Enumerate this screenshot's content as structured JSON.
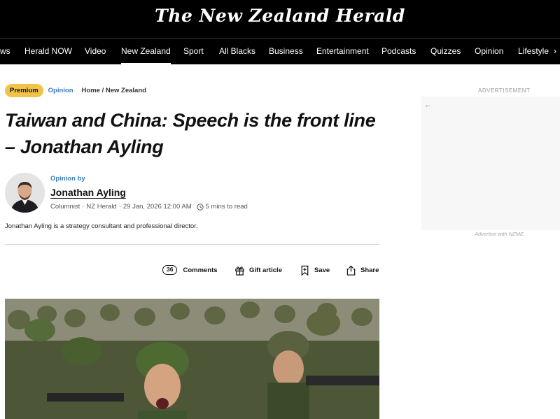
{
  "header": {
    "masthead": "The New Zealand Herald",
    "nav": [
      {
        "label": "ws"
      },
      {
        "label": "Herald NOW"
      },
      {
        "label": "Video"
      },
      {
        "label": "New Zealand",
        "active": true
      },
      {
        "label": "Sport"
      },
      {
        "label": "All Blacks"
      },
      {
        "label": "Business"
      },
      {
        "label": "Entertainment"
      },
      {
        "label": "Podcasts"
      },
      {
        "label": "Quizzes"
      },
      {
        "label": "Opinion"
      },
      {
        "label": "Lifestyle"
      }
    ],
    "nav_arrow_icon": "chevron-right-icon"
  },
  "article": {
    "premium_badge": "Premium",
    "section_badge": "Opinion",
    "breadcrumb": "Home / New Zealand",
    "headline": "Taiwan and China: Speech is the front line – Jonathan Ayling",
    "byline": {
      "label": "Opinion by",
      "author": "Jonathan Ayling",
      "role": "Columnist",
      "publication": "NZ Herald",
      "date": "29 Jan, 2026 12:00 AM",
      "read_time": "5 mins to read"
    },
    "bio": "Jonathan Ayling is a strategy consultant and professional director.",
    "actions": {
      "comment_count": "36",
      "comments": "Comments",
      "gift": "Gift article",
      "save": "Save",
      "share": "Share"
    }
  },
  "ad": {
    "label": "ADVERTISEMENT",
    "back_icon": "arrow-left-icon",
    "caption": "Advertise with NZME."
  },
  "colors": {
    "premium": "#f0c34a",
    "opinion_blue": "#3a7bbf",
    "header_bg": "#000000"
  }
}
